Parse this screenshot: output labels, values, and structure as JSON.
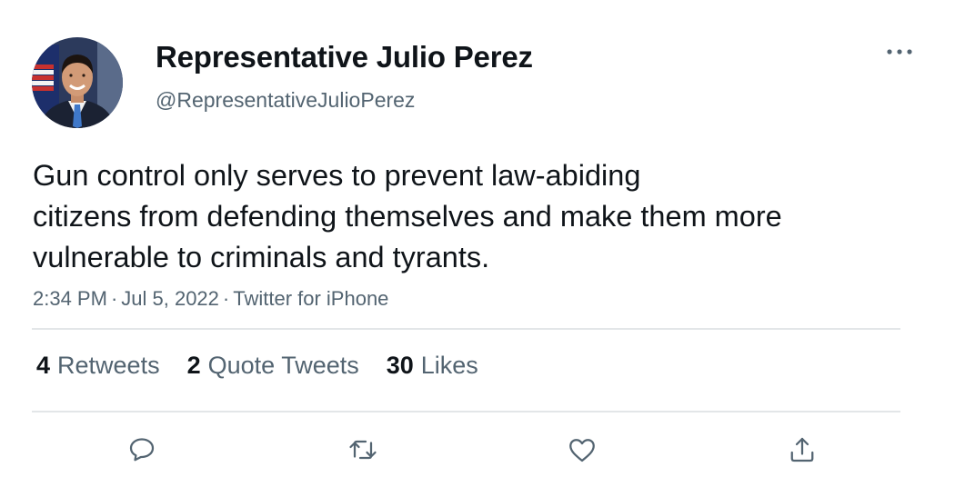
{
  "author": {
    "display_name": "Representative Julio Perez",
    "handle": "@RepresentativeJulioPerez"
  },
  "tweet": {
    "lines": [
      "Gun control only serves to prevent law-abiding",
      "citizens from defending themselves and make them more",
      "vulnerable to criminals and tyrants."
    ],
    "time": "2:34 PM",
    "date": "Jul 5, 2022",
    "source": "Twitter for iPhone",
    "separator": "·"
  },
  "stats": {
    "retweets": {
      "count": "4",
      "label": "Retweets"
    },
    "quotes": {
      "count": "2",
      "label": "Quote Tweets"
    },
    "likes": {
      "count": "30",
      "label": "Likes"
    }
  },
  "icons": {
    "more": "more-icon",
    "reply": "reply-icon",
    "retweet": "retweet-icon",
    "like": "heart-icon",
    "share": "share-icon"
  },
  "colors": {
    "text_primary": "#0f1419",
    "text_secondary": "#536471",
    "icon": "#536471",
    "divider": "#e3e6e8"
  }
}
